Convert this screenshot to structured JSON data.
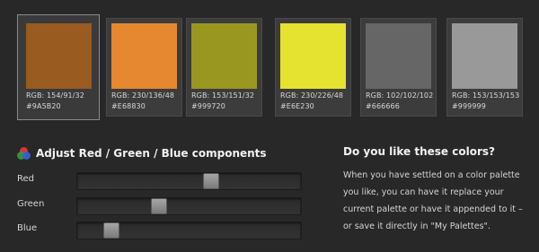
{
  "palette": [
    {
      "rgb": "RGB: 154/91/32",
      "hex": "#9A5B20",
      "color": "#9A5B20",
      "selected": true
    },
    {
      "rgb": "RGB: 230/136/48",
      "hex": "#E68830",
      "color": "#E68830",
      "selected": false
    },
    {
      "rgb": "RGB: 153/151/32",
      "hex": "#999720",
      "color": "#999720",
      "selected": false
    },
    {
      "rgb": "RGB: 230/226/48",
      "hex": "#E6E230",
      "color": "#E6E230",
      "selected": false
    },
    {
      "rgb": "RGB: 102/102/102",
      "hex": "#666666",
      "color": "#666666",
      "selected": false
    },
    {
      "rgb": "RGB: 153/153/153",
      "hex": "#999999",
      "color": "#999999",
      "selected": false
    }
  ],
  "adjust": {
    "title": "Adjust Red / Green / Blue components",
    "icon": "rgb-circles-icon",
    "sliders": [
      {
        "label": "Red",
        "value": 154,
        "max": 255
      },
      {
        "label": "Green",
        "value": 91,
        "max": 255
      },
      {
        "label": "Blue",
        "value": 32,
        "max": 255
      }
    ]
  },
  "info": {
    "title": "Do you like these colors?",
    "text": "When you have settled on a color palette you like, you can have it replace your current palette or have it appended to it – or save it directly in \"My Palettes\"."
  }
}
